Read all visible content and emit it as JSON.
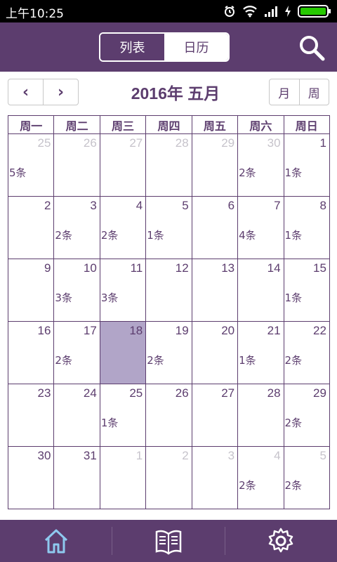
{
  "status": {
    "time": "上午10:25"
  },
  "header": {
    "tabs": [
      "列表",
      "日历"
    ],
    "active_tab": "日历"
  },
  "calendar_nav": {
    "prev": "‹",
    "next": "›",
    "title": "2016年 五月",
    "views": [
      "月",
      "周"
    ],
    "active_view": "月"
  },
  "weekdays": [
    "周一",
    "周二",
    "周三",
    "周四",
    "周五",
    "周六",
    "周日"
  ],
  "weeks": [
    [
      {
        "day": "25",
        "other": true,
        "count": "5条"
      },
      {
        "day": "26",
        "other": true
      },
      {
        "day": "27",
        "other": true
      },
      {
        "day": "28",
        "other": true
      },
      {
        "day": "29",
        "other": true
      },
      {
        "day": "30",
        "other": true,
        "count": "2条"
      },
      {
        "day": "1",
        "count": "1条"
      }
    ],
    [
      {
        "day": "2"
      },
      {
        "day": "3",
        "count": "2条"
      },
      {
        "day": "4",
        "count": "2条"
      },
      {
        "day": "5",
        "count": "1条"
      },
      {
        "day": "6"
      },
      {
        "day": "7",
        "count": "4条"
      },
      {
        "day": "8",
        "count": "1条"
      }
    ],
    [
      {
        "day": "9"
      },
      {
        "day": "10",
        "count": "3条"
      },
      {
        "day": "11",
        "count": "3条"
      },
      {
        "day": "12"
      },
      {
        "day": "13"
      },
      {
        "day": "14"
      },
      {
        "day": "15",
        "count": "1条"
      }
    ],
    [
      {
        "day": "16"
      },
      {
        "day": "17",
        "count": "2条"
      },
      {
        "day": "18",
        "selected": true
      },
      {
        "day": "19",
        "count": "2条"
      },
      {
        "day": "20"
      },
      {
        "day": "21",
        "count": "1条"
      },
      {
        "day": "22",
        "count": "2条"
      }
    ],
    [
      {
        "day": "23"
      },
      {
        "day": "24"
      },
      {
        "day": "25",
        "count": "1条"
      },
      {
        "day": "26"
      },
      {
        "day": "27"
      },
      {
        "day": "28"
      },
      {
        "day": "29",
        "count": "2条"
      }
    ],
    [
      {
        "day": "30"
      },
      {
        "day": "31"
      },
      {
        "day": "1",
        "other": true
      },
      {
        "day": "2",
        "other": true
      },
      {
        "day": "3",
        "other": true
      },
      {
        "day": "4",
        "other": true,
        "count": "2条"
      },
      {
        "day": "5",
        "other": true,
        "count": "2条"
      }
    ]
  ],
  "bottom_nav": [
    "home-icon",
    "book-icon",
    "settings-icon"
  ],
  "colors": {
    "primary": "#5c3d6e",
    "selected": "#b1a5c8",
    "muted_day": "#c6c3cb",
    "home_icon": "#8ec9ef",
    "status_bar": "#000000"
  }
}
